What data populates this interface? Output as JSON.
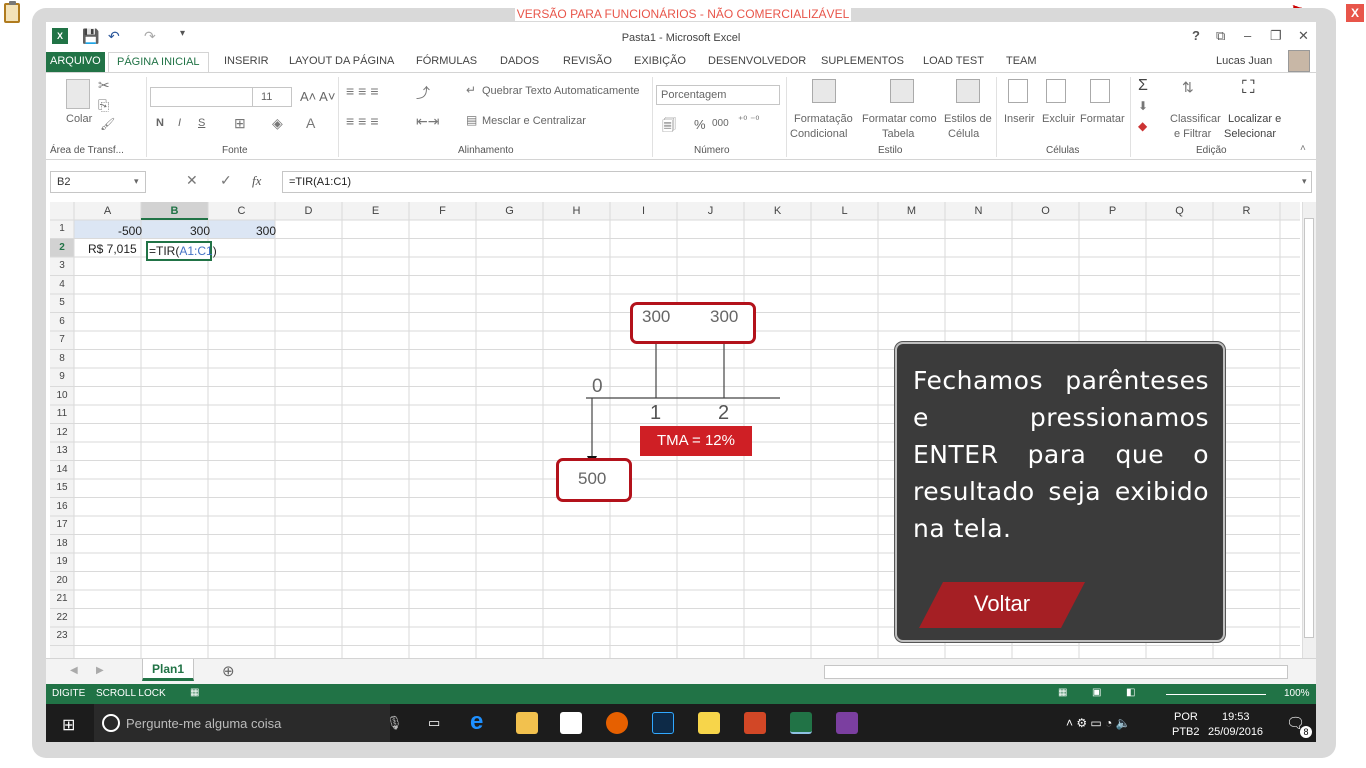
{
  "overlay": {
    "watermark": "VERSÃO PARA FUNCIONÁRIOS - NÃO COMERCIALIZÁVEL",
    "close_label": "X"
  },
  "window": {
    "title": "Pasta1 - Microsoft Excel",
    "help": "?",
    "user": "Lucas Juan"
  },
  "tabs": [
    "ARQUIVO",
    "PÁGINA INICIAL",
    "INSERIR",
    "LAYOUT DA PÁGINA",
    "FÓRMULAS",
    "DADOS",
    "REVISÃO",
    "EXIBIÇÃO",
    "DESENVOLVEDOR",
    "SUPLEMENTOS",
    "LOAD TEST",
    "TEAM"
  ],
  "ribbon": {
    "paste_label": "Colar",
    "font_size": "11",
    "bold": "N",
    "italic": "I",
    "underline": "S",
    "wrap_text": "Quebrar Texto Automaticamente",
    "merge_center": "Mesclar e Centralizar",
    "number_format": "Porcentagem",
    "percent": "%",
    "thousands": "000",
    "cond_format_1": "Formatação",
    "cond_format_2": "Condicional",
    "format_table_1": "Formatar como",
    "format_table_2": "Tabela",
    "cell_styles_1": "Estilos de",
    "cell_styles_2": "Célula",
    "insert": "Inserir",
    "delete": "Excluir",
    "format": "Formatar",
    "sort_1": "Classificar",
    "sort_2": "e Filtrar",
    "find_1": "Localizar e",
    "find_2": "Selecionar",
    "groups": {
      "clipboard": "Área de Transf...",
      "font": "Fonte",
      "alignment": "Alinhamento",
      "number": "Número",
      "styles": "Estilo",
      "cells": "Células",
      "editing": "Edição"
    }
  },
  "formula_bar": {
    "name_box": "B2",
    "fx": "fx",
    "formula": "=TIR(A1:C1)"
  },
  "grid": {
    "columns": [
      "A",
      "B",
      "C",
      "D",
      "E",
      "F",
      "G",
      "H",
      "I",
      "J",
      "K",
      "L",
      "M",
      "N",
      "O",
      "P",
      "Q",
      "R"
    ],
    "rows": [
      "1",
      "2",
      "3",
      "4",
      "5",
      "6",
      "7",
      "8",
      "9",
      "10",
      "11",
      "12",
      "13",
      "14",
      "15",
      "16",
      "17",
      "18",
      "19",
      "20",
      "21",
      "22",
      "23"
    ],
    "cells": {
      "A1": "-500",
      "B1": "300",
      "C1": "300",
      "A2": "R$ 7,015",
      "B2_prefix": "=TIR(",
      "B2_ref": "A1:C1",
      "B2_suffix": ")"
    }
  },
  "diagram": {
    "inflow_1": "300",
    "inflow_2": "300",
    "period_0": "0",
    "period_1": "1",
    "period_2": "2",
    "outflow": "500",
    "tma": "TMA = 12%"
  },
  "note": {
    "text": "Fechamos parênteses e pressionamos ENTER para que o resultado seja exibido na tela.",
    "back_button": "Voltar"
  },
  "sheet": {
    "tab": "Plan1",
    "add": "⊕"
  },
  "status": {
    "mode": "DIGITE",
    "scroll_lock": "SCROLL LOCK",
    "zoom": "100%"
  },
  "taskbar": {
    "search_placeholder": "Pergunte-me alguma coisa",
    "lang_1": "POR",
    "lang_2": "PTB2",
    "time": "19:53",
    "date": "25/09/2016",
    "notif_count": "8"
  },
  "colors": {
    "excel_green": "#217346",
    "accent_red": "#b3121b",
    "watermark_red": "#e8554a",
    "note_bg": "#3b3b3b"
  }
}
